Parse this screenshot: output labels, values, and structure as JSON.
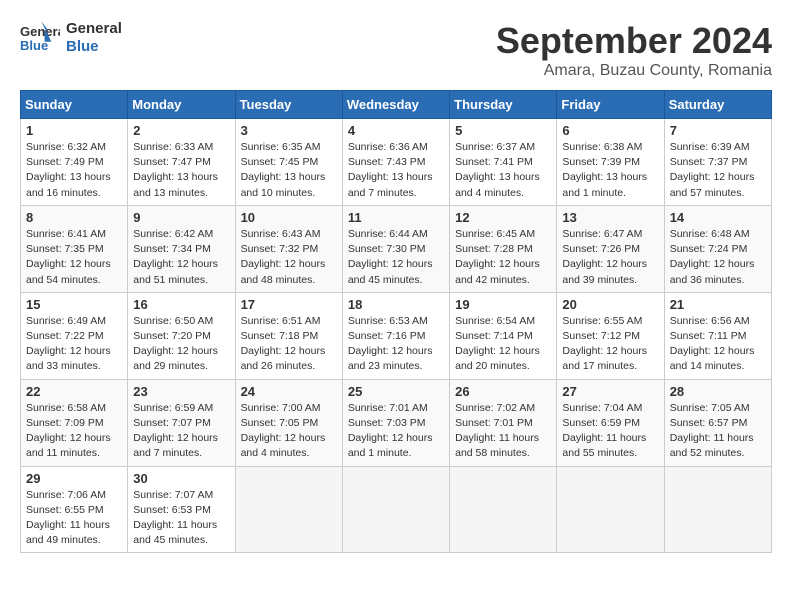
{
  "header": {
    "logo_line1": "General",
    "logo_line2": "Blue",
    "title": "September 2024",
    "subtitle": "Amara, Buzau County, Romania"
  },
  "weekdays": [
    "Sunday",
    "Monday",
    "Tuesday",
    "Wednesday",
    "Thursday",
    "Friday",
    "Saturday"
  ],
  "weeks": [
    [
      {
        "day": "1",
        "info": "Sunrise: 6:32 AM\nSunset: 7:49 PM\nDaylight: 13 hours\nand 16 minutes."
      },
      {
        "day": "2",
        "info": "Sunrise: 6:33 AM\nSunset: 7:47 PM\nDaylight: 13 hours\nand 13 minutes."
      },
      {
        "day": "3",
        "info": "Sunrise: 6:35 AM\nSunset: 7:45 PM\nDaylight: 13 hours\nand 10 minutes."
      },
      {
        "day": "4",
        "info": "Sunrise: 6:36 AM\nSunset: 7:43 PM\nDaylight: 13 hours\nand 7 minutes."
      },
      {
        "day": "5",
        "info": "Sunrise: 6:37 AM\nSunset: 7:41 PM\nDaylight: 13 hours\nand 4 minutes."
      },
      {
        "day": "6",
        "info": "Sunrise: 6:38 AM\nSunset: 7:39 PM\nDaylight: 13 hours\nand 1 minute."
      },
      {
        "day": "7",
        "info": "Sunrise: 6:39 AM\nSunset: 7:37 PM\nDaylight: 12 hours\nand 57 minutes."
      }
    ],
    [
      {
        "day": "8",
        "info": "Sunrise: 6:41 AM\nSunset: 7:35 PM\nDaylight: 12 hours\nand 54 minutes."
      },
      {
        "day": "9",
        "info": "Sunrise: 6:42 AM\nSunset: 7:34 PM\nDaylight: 12 hours\nand 51 minutes."
      },
      {
        "day": "10",
        "info": "Sunrise: 6:43 AM\nSunset: 7:32 PM\nDaylight: 12 hours\nand 48 minutes."
      },
      {
        "day": "11",
        "info": "Sunrise: 6:44 AM\nSunset: 7:30 PM\nDaylight: 12 hours\nand 45 minutes."
      },
      {
        "day": "12",
        "info": "Sunrise: 6:45 AM\nSunset: 7:28 PM\nDaylight: 12 hours\nand 42 minutes."
      },
      {
        "day": "13",
        "info": "Sunrise: 6:47 AM\nSunset: 7:26 PM\nDaylight: 12 hours\nand 39 minutes."
      },
      {
        "day": "14",
        "info": "Sunrise: 6:48 AM\nSunset: 7:24 PM\nDaylight: 12 hours\nand 36 minutes."
      }
    ],
    [
      {
        "day": "15",
        "info": "Sunrise: 6:49 AM\nSunset: 7:22 PM\nDaylight: 12 hours\nand 33 minutes."
      },
      {
        "day": "16",
        "info": "Sunrise: 6:50 AM\nSunset: 7:20 PM\nDaylight: 12 hours\nand 29 minutes."
      },
      {
        "day": "17",
        "info": "Sunrise: 6:51 AM\nSunset: 7:18 PM\nDaylight: 12 hours\nand 26 minutes."
      },
      {
        "day": "18",
        "info": "Sunrise: 6:53 AM\nSunset: 7:16 PM\nDaylight: 12 hours\nand 23 minutes."
      },
      {
        "day": "19",
        "info": "Sunrise: 6:54 AM\nSunset: 7:14 PM\nDaylight: 12 hours\nand 20 minutes."
      },
      {
        "day": "20",
        "info": "Sunrise: 6:55 AM\nSunset: 7:12 PM\nDaylight: 12 hours\nand 17 minutes."
      },
      {
        "day": "21",
        "info": "Sunrise: 6:56 AM\nSunset: 7:11 PM\nDaylight: 12 hours\nand 14 minutes."
      }
    ],
    [
      {
        "day": "22",
        "info": "Sunrise: 6:58 AM\nSunset: 7:09 PM\nDaylight: 12 hours\nand 11 minutes."
      },
      {
        "day": "23",
        "info": "Sunrise: 6:59 AM\nSunset: 7:07 PM\nDaylight: 12 hours\nand 7 minutes."
      },
      {
        "day": "24",
        "info": "Sunrise: 7:00 AM\nSunset: 7:05 PM\nDaylight: 12 hours\nand 4 minutes."
      },
      {
        "day": "25",
        "info": "Sunrise: 7:01 AM\nSunset: 7:03 PM\nDaylight: 12 hours\nand 1 minute."
      },
      {
        "day": "26",
        "info": "Sunrise: 7:02 AM\nSunset: 7:01 PM\nDaylight: 11 hours\nand 58 minutes."
      },
      {
        "day": "27",
        "info": "Sunrise: 7:04 AM\nSunset: 6:59 PM\nDaylight: 11 hours\nand 55 minutes."
      },
      {
        "day": "28",
        "info": "Sunrise: 7:05 AM\nSunset: 6:57 PM\nDaylight: 11 hours\nand 52 minutes."
      }
    ],
    [
      {
        "day": "29",
        "info": "Sunrise: 7:06 AM\nSunset: 6:55 PM\nDaylight: 11 hours\nand 49 minutes."
      },
      {
        "day": "30",
        "info": "Sunrise: 7:07 AM\nSunset: 6:53 PM\nDaylight: 11 hours\nand 45 minutes."
      },
      {
        "day": "",
        "info": ""
      },
      {
        "day": "",
        "info": ""
      },
      {
        "day": "",
        "info": ""
      },
      {
        "day": "",
        "info": ""
      },
      {
        "day": "",
        "info": ""
      }
    ]
  ]
}
